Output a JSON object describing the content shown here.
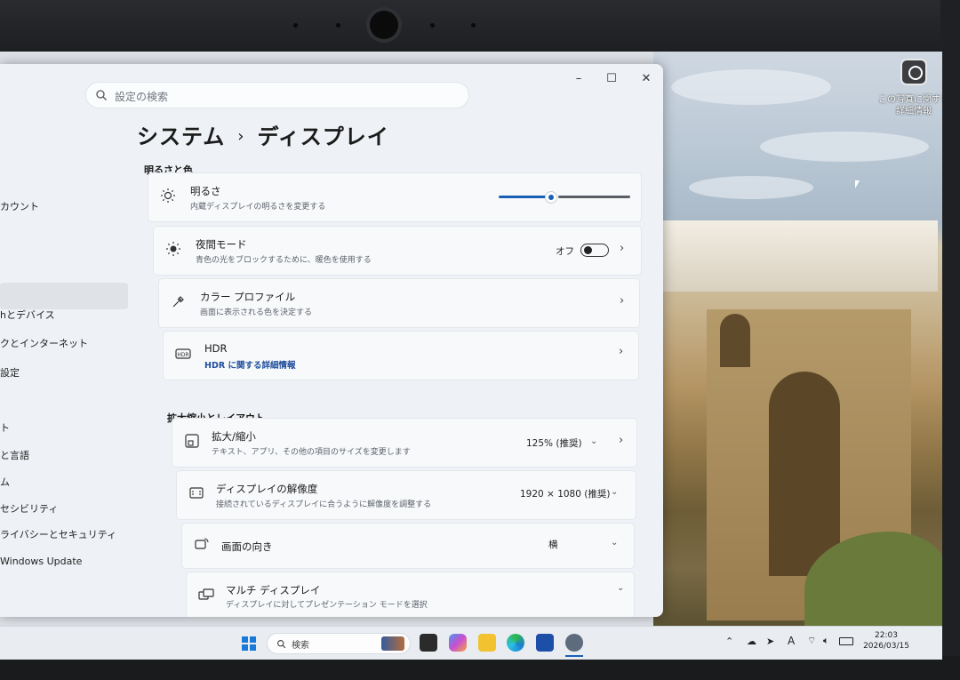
{
  "window": {
    "search_placeholder": "設定の検索",
    "minimize": "–",
    "maximize": "☐",
    "close": "✕"
  },
  "sidebar": {
    "items": [
      {
        "label": "カウント"
      },
      {
        "label": "hとデバイス"
      },
      {
        "label": "クとインターネット"
      },
      {
        "label": "設定"
      },
      {
        "label": "ト"
      },
      {
        "label": "と言語"
      },
      {
        "label": "ム"
      },
      {
        "label": "セシビリティ"
      },
      {
        "label": "ライバシーとセキュリティ"
      },
      {
        "label": "Windows Update"
      }
    ]
  },
  "breadcrumb": {
    "parent": "システム",
    "separator": "›",
    "current": "ディスプレイ"
  },
  "sections": {
    "brightness_color": "明るさと色",
    "scale_layout": "拡大縮小とレイアウト"
  },
  "brightness": {
    "title": "明るさ",
    "desc": "内蔵ディスプレイの明るさを変更する",
    "level": 0.4
  },
  "night_light": {
    "title": "夜間モード",
    "desc": "青色の光をブロックするために、暖色を使用する",
    "state": "オフ"
  },
  "color_profile": {
    "title": "カラー プロファイル",
    "desc": "画面に表示される色を決定する"
  },
  "hdr": {
    "title": "HDR",
    "link": "HDR に関する詳細情報"
  },
  "scale": {
    "title": "拡大/縮小",
    "desc": "テキスト、アプリ、その他の項目のサイズを変更します",
    "value": "125% (推奨)"
  },
  "resolution": {
    "title": "ディスプレイの解像度",
    "desc": "接続されているディスプレイに合うように解像度を調整する",
    "value": "1920 × 1080 (推奨)"
  },
  "orientation": {
    "title": "画面の向き",
    "value": "横"
  },
  "multi_display": {
    "title": "マルチ ディスプレイ",
    "desc": "ディスプレイに対してプレゼンテーション モードを選択"
  },
  "desktop": {
    "icon_label": "この写真に関する詳細情報"
  },
  "taskbar": {
    "search_label": "検索",
    "time": "22:03",
    "date": "2026/03/15",
    "ime": "A"
  },
  "colors": {
    "accent": "#1a5fb4",
    "link": "#1f4e9c"
  }
}
